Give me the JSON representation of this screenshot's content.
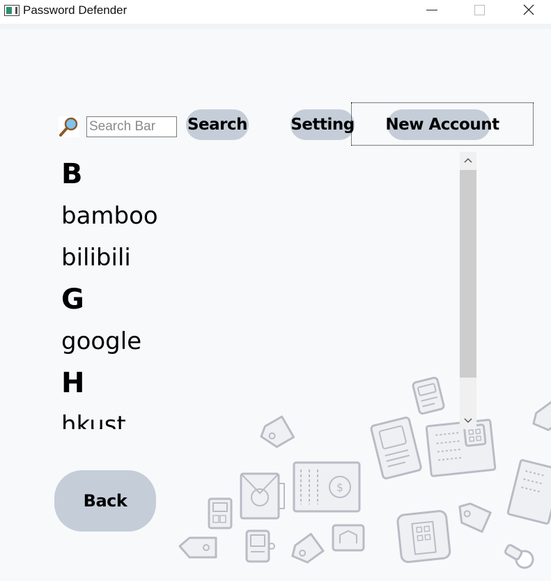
{
  "window": {
    "title": "Password Defender"
  },
  "toolbar": {
    "search_placeholder": "Search Bar",
    "search_value": "",
    "search_button_label": "Search",
    "setting_button_label": "Setting",
    "new_account_button_label": "New Account"
  },
  "account_list": {
    "rows": [
      {
        "type": "header",
        "text": "B"
      },
      {
        "type": "item",
        "text": "bamboo"
      },
      {
        "type": "item",
        "text": "bilibili"
      },
      {
        "type": "header",
        "text": "G"
      },
      {
        "type": "item",
        "text": "google"
      },
      {
        "type": "header",
        "text": "H"
      },
      {
        "type": "item",
        "text": "hkust"
      }
    ]
  },
  "footer": {
    "back_button_label": "Back"
  },
  "colors": {
    "button_fill": "#c5cdd8",
    "background": "#f7f9fb",
    "illustration_stroke": "#b8bcc4"
  }
}
